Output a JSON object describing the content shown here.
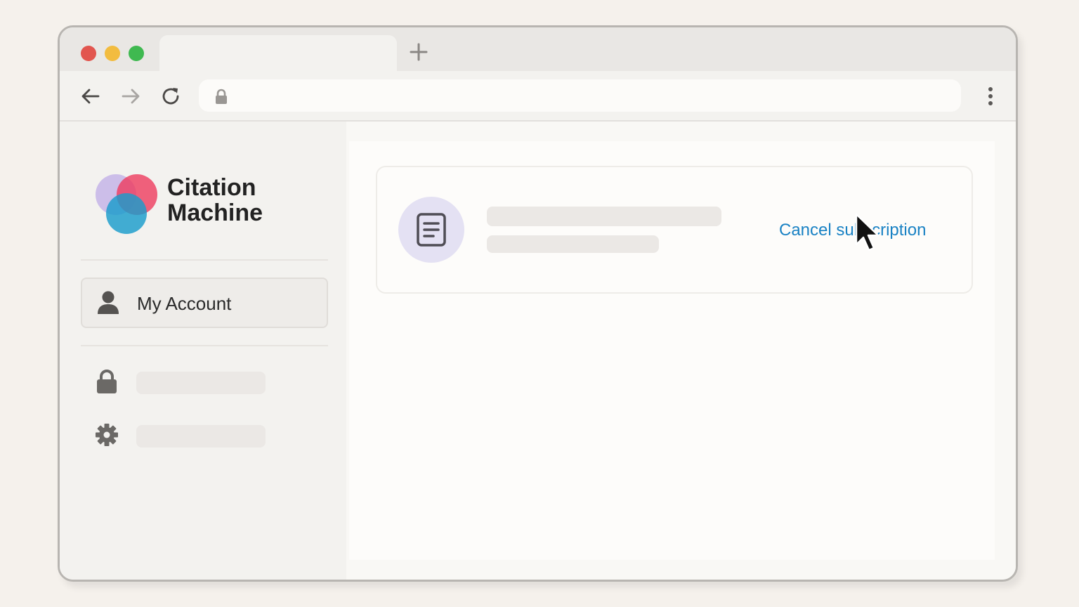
{
  "browser": {
    "traffic_lights": {
      "close_color": "#e2564f",
      "minimize_color": "#f2bc3f",
      "maximize_color": "#3fb950"
    },
    "tab": {
      "title": ""
    },
    "new_tab_icon": "plus-icon",
    "nav": {
      "back_icon": "arrow-left-icon",
      "forward_icon": "arrow-right-icon",
      "reload_icon": "reload-icon"
    },
    "address_bar": {
      "value": "",
      "lock_icon": "lock-icon"
    },
    "menu_icon": "kebab-menu-icon"
  },
  "sidebar": {
    "logo": {
      "name": "Citation Machine",
      "line1": "Citation",
      "line2": "Machine",
      "colors": [
        "#c4b5e8",
        "#ee3b5e",
        "#1a9ccc"
      ]
    },
    "items": [
      {
        "label": "My Account",
        "icon": "person-icon",
        "active": true
      },
      {
        "label": "",
        "icon": "lock-icon",
        "active": false
      },
      {
        "label": "",
        "icon": "gear-icon",
        "active": false
      }
    ]
  },
  "main": {
    "subscription_card": {
      "icon": "document-icon",
      "title": "",
      "subtitle": "",
      "action_label": "Cancel subscription",
      "action_color": "#1a82c4"
    }
  },
  "pointer": {
    "icon": "mouse-cursor-icon"
  }
}
